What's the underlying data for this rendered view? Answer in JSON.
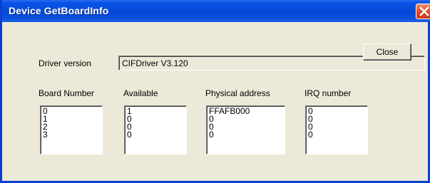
{
  "window": {
    "title": "Device GetBoardInfo",
    "close_glyph": "✕"
  },
  "driver": {
    "label": "Driver version",
    "value": "CIFDriver V3.120"
  },
  "buttons": {
    "close_label": "Close"
  },
  "columns": [
    {
      "label": "Board Number",
      "values": [
        "0",
        "1",
        "2",
        "3"
      ]
    },
    {
      "label": "Available",
      "values": [
        "1",
        "0",
        "0",
        "0"
      ]
    },
    {
      "label": "Physical address",
      "values": [
        "FFAFB000",
        "0",
        "0",
        "0"
      ]
    },
    {
      "label": "IRQ number",
      "values": [
        "0",
        "0",
        "0",
        "0"
      ]
    }
  ],
  "colors": {
    "titlebar": "#0648d8",
    "dialog_bg": "#ece9d8",
    "close_red": "#e0522e"
  }
}
